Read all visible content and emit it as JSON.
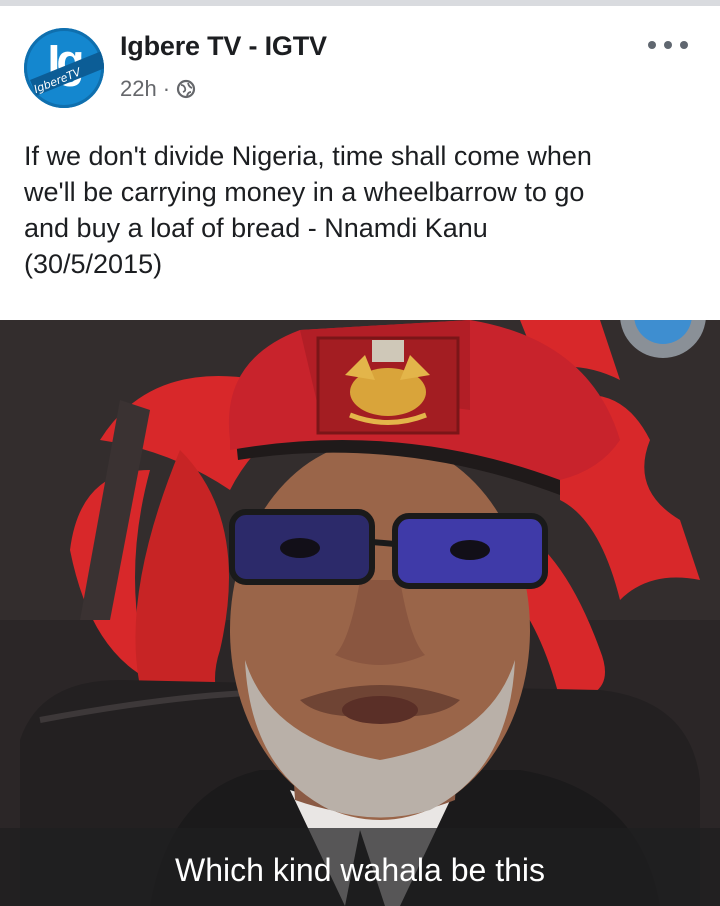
{
  "post": {
    "page_name": "Igbere TV - IGTV",
    "time": "22h",
    "separator": "·",
    "privacy_icon": "globe-icon",
    "more_icon": "more-options-icon",
    "avatar": {
      "monogram": "Ig",
      "ribbon_text": "IgbereTV",
      "color": "#1487cf"
    },
    "text_lines": [
      "If we don't divide Nigeria, time shall come when",
      "we'll be carrying money in a wheelbarrow to go",
      "and buy a loaf of bread - Nnamdi Kanu",
      "(30/5/2015)"
    ]
  },
  "video": {
    "subtitle": "Which kind wahala be this",
    "colors": {
      "beret": "#c8232c",
      "flag_red": "#d8282a",
      "background": "#2b2627"
    }
  }
}
